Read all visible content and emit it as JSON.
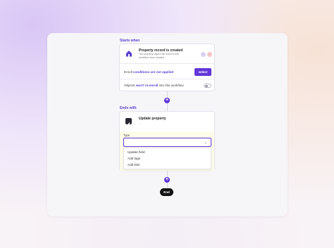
{
  "trigger": {
    "section_label": "Starts when",
    "title": "Property record is created",
    "description": "The property object will enroll in this workflow once created.",
    "conditions_prefix": "Enroll",
    "conditions_highlight": "conditions are not applied",
    "select_label": "select",
    "reenroll_prefix": "Objects",
    "reenroll_highlight": "won't re-enroll",
    "reenroll_suffix": "into this workflow."
  },
  "action": {
    "section_label": "Ends with",
    "title": "Update property",
    "subtitle": "-",
    "type_label": "Type",
    "type_value": "",
    "options": [
      "Update field",
      "Add tags",
      "Add lists"
    ]
  },
  "end_label": "End",
  "colors": {
    "accent": "#6236d9",
    "end_button": "#111111"
  }
}
